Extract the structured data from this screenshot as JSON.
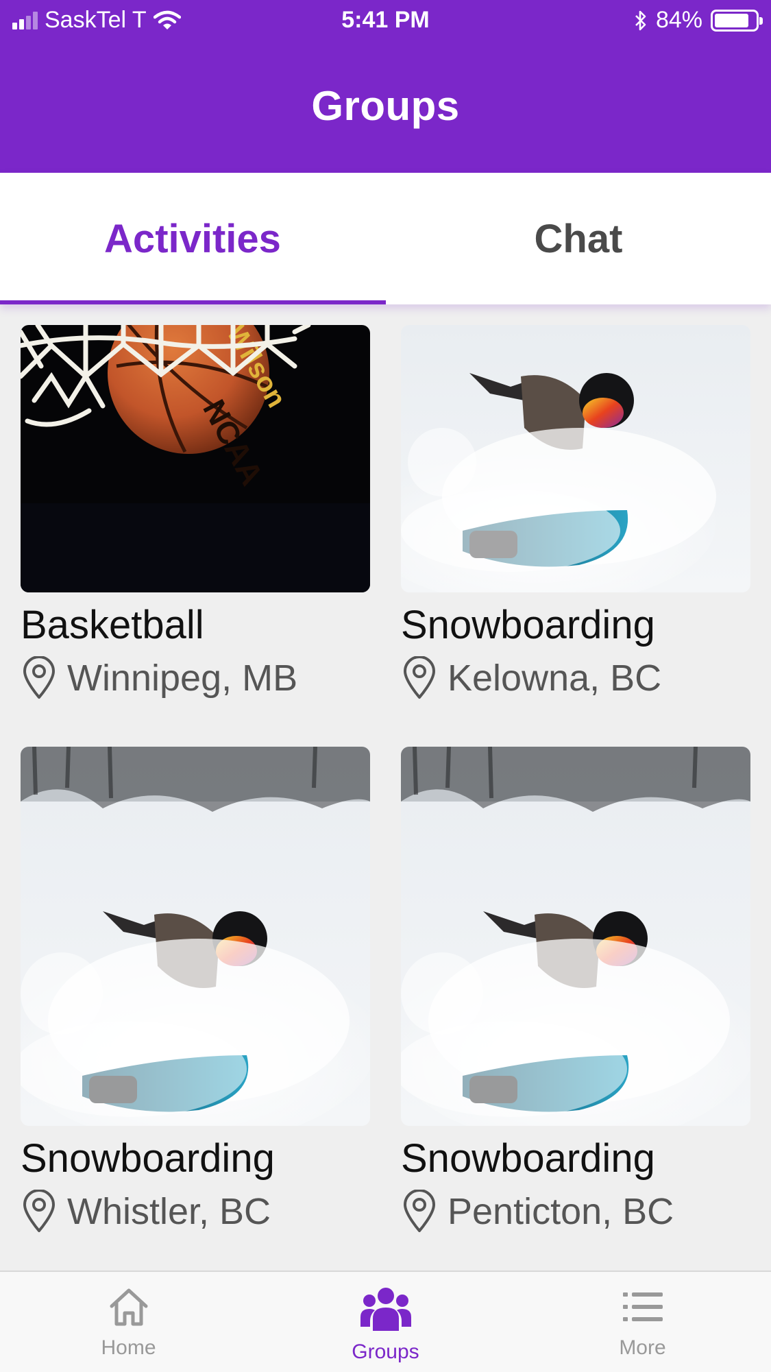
{
  "status_bar": {
    "carrier": "SaskTel T",
    "time": "5:41 PM",
    "battery_percent": "84%",
    "battery_level": 0.84,
    "signal_bars": 2,
    "icons": [
      "signal-icon",
      "wifi-icon",
      "bluetooth-icon",
      "battery-icon"
    ]
  },
  "header": {
    "title": "Groups",
    "background_color": "#7b27c9"
  },
  "tabs": [
    {
      "label": "Activities",
      "active": true
    },
    {
      "label": "Chat",
      "active": false
    }
  ],
  "activities": [
    {
      "title": "Basketball",
      "location": "Winnipeg, MB",
      "image": "basketball-photo"
    },
    {
      "title": "Snowboarding",
      "location": "Kelowna, BC",
      "image": "snowboarding-photo"
    },
    {
      "title": "Snowboarding",
      "location": "Whistler, BC",
      "image": "snowboarding-photo"
    },
    {
      "title": "Snowboarding",
      "location": "Penticton, BC",
      "image": "snowboarding-photo"
    }
  ],
  "bottom_nav": [
    {
      "label": "Home",
      "icon": "home-icon",
      "active": false
    },
    {
      "label": "Groups",
      "icon": "groups-icon",
      "active": true
    },
    {
      "label": "More",
      "icon": "menu-list-icon",
      "active": false
    }
  ],
  "colors": {
    "accent": "#7b27c9",
    "inactive_nav": "#999999",
    "background": "#efefef"
  }
}
